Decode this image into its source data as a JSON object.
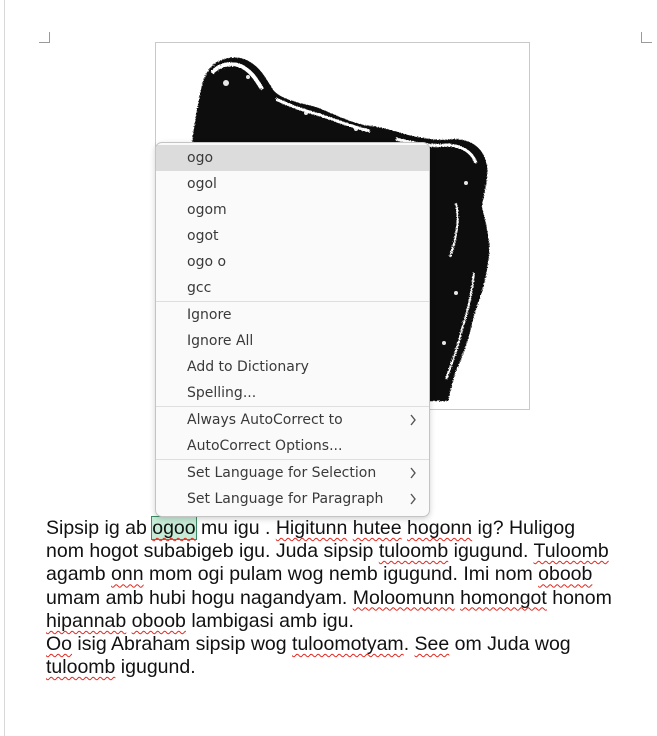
{
  "document": {
    "paragraph1": [
      {
        "t": "Sipsip ig ab "
      },
      {
        "t": "ogoo",
        "selected": true,
        "misspelled": true
      },
      {
        "t": " mu igu . "
      },
      {
        "t": "Higitunn",
        "misspelled": true
      },
      {
        "t": " "
      },
      {
        "t": "hutee",
        "misspelled": true
      },
      {
        "t": " "
      },
      {
        "t": "hogonn",
        "misspelled": true
      },
      {
        "t": " ig? Huligog nom hogot subabigeb igu. Juda  sipsip "
      },
      {
        "t": "tuloomb",
        "misspelled": true
      },
      {
        "t": " igugund. "
      },
      {
        "t": "Tuloomb",
        "misspelled": true
      },
      {
        "t": " agamb "
      },
      {
        "t": "onn",
        "misspelled": true
      },
      {
        "t": " mom ogi pulam wog nemb igugund. Imi nom "
      },
      {
        "t": "oboob",
        "misspelled": true
      },
      {
        "t": " umam amb hubi hogu nagandyam. "
      },
      {
        "t": "Moloomunn",
        "misspelled": true
      },
      {
        "t": " "
      },
      {
        "t": "homongot",
        "misspelled": true
      },
      {
        "t": " honom "
      },
      {
        "t": "hipannab",
        "misspelled": true
      },
      {
        "t": " "
      },
      {
        "t": "oboob",
        "misspelled": true
      },
      {
        "t": " lambigasi amb igu."
      }
    ],
    "paragraph2": [
      {
        "t": "Oo",
        "misspelled": true
      },
      {
        "t": " isig Abraham sipsip wog "
      },
      {
        "t": "tuloomotyam",
        "misspelled": true
      },
      {
        "t": ". "
      },
      {
        "t": "See",
        "misspelled": true
      },
      {
        "t": " om Juda wog "
      },
      {
        "t": "tuloomb",
        "misspelled": true
      },
      {
        "t": " igugund."
      }
    ]
  },
  "context_menu": {
    "suggestions": [
      "ogo",
      "ogol",
      "ogom",
      "ogot",
      "ogo o",
      "gcc"
    ],
    "spell_actions": [
      "Ignore",
      "Ignore All",
      "Add to Dictionary",
      "Spelling..."
    ],
    "autocorrect": {
      "always_autocorrect_to": "Always AutoCorrect to",
      "autocorrect_options": "AutoCorrect Options..."
    },
    "language": {
      "for_selection": "Set Language for Selection",
      "for_paragraph": "Set Language for Paragraph"
    },
    "highlighted_item": "ogo",
    "icons": {
      "submenu": "chevron-right-icon"
    }
  },
  "colors": {
    "misspelling_underline": "#e0271f",
    "selection_fill": "#c6ebd6",
    "menu_highlight": "#dcdcdc"
  }
}
